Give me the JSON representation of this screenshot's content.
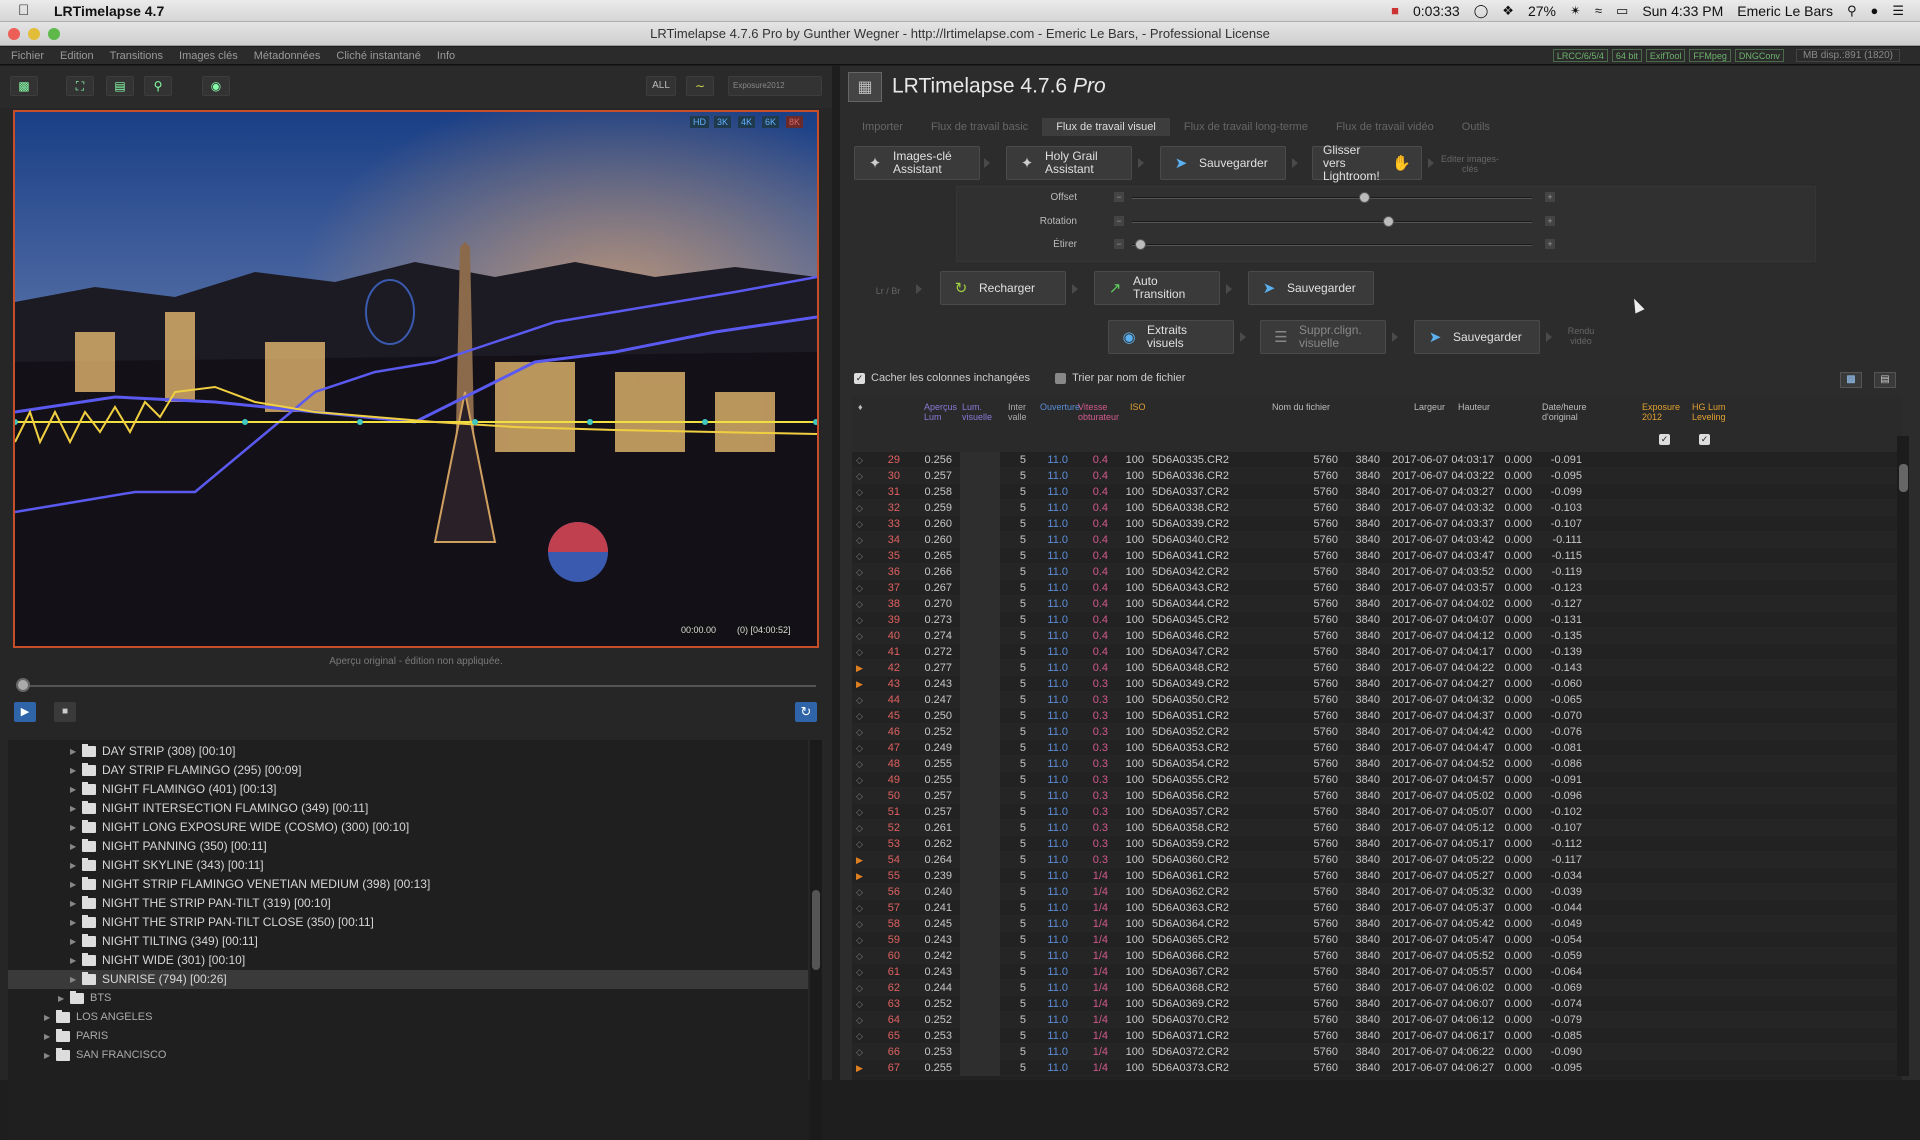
{
  "menubar": {
    "app": "LRTimelapse 4.7",
    "timer": "0:03:33",
    "battery": "27%",
    "clock": "Sun 4:33 PM",
    "user": "Emeric Le Bars"
  },
  "window": {
    "title": "LRTimelapse 4.7.6 Pro by Gunther Wegner - http://lrtimelapse.com - Emeric Le Bars, - Professional License"
  },
  "appmenu": {
    "items": [
      "Fichier",
      "Edition",
      "Transitions",
      "Images clés",
      "Métadonnées",
      "Cliché instantané",
      "Info"
    ],
    "badges": [
      "LRCC/6/5/4",
      "64 bit",
      "ExifTool",
      "FFMpeg",
      "DNGConv"
    ],
    "memory": "MB disp.:891 (1820)"
  },
  "toolbar": {
    "all_label": "ALL",
    "preset": "Exposure2012"
  },
  "preview": {
    "res": [
      "HD",
      "3K",
      "4K",
      "6K",
      "8K"
    ],
    "time_start": "00:00.00",
    "time_end": "(0) [04:00:52]",
    "caption": "Aperçu original - édition non appliquée."
  },
  "tree": {
    "items": [
      {
        "label": "DAY STRIP (308) [00:10]",
        "level": 3
      },
      {
        "label": "DAY STRIP FLAMINGO (295) [00:09]",
        "level": 3
      },
      {
        "label": "NIGHT FLAMINGO (401) [00:13]",
        "level": 3
      },
      {
        "label": "NIGHT INTERSECTION FLAMINGO (349) [00:11]",
        "level": 3
      },
      {
        "label": "NIGHT LONG EXPOSURE WIDE (COSMO) (300) [00:10]",
        "level": 3
      },
      {
        "label": "NIGHT PANNING (350) [00:11]",
        "level": 3
      },
      {
        "label": "NIGHT SKYLINE  (343) [00:11]",
        "level": 3
      },
      {
        "label": "NIGHT STRIP FLAMINGO VENETIAN MEDIUM (398) [00:13]",
        "level": 3
      },
      {
        "label": "NIGHT THE STRIP PAN-TILT (319) [00:10]",
        "level": 3
      },
      {
        "label": "NIGHT THE STRIP PAN-TILT CLOSE (350) [00:11]",
        "level": 3
      },
      {
        "label": "NIGHT TILTING (349) [00:11]",
        "level": 3
      },
      {
        "label": "NIGHT WIDE (301) [00:10]",
        "level": 3
      },
      {
        "label": "SUNRISE (794) [00:26]",
        "level": 3,
        "selected": true
      },
      {
        "label": "BTS",
        "level": 2
      },
      {
        "label": "LOS ANGELES",
        "level": 1
      },
      {
        "label": "PARIS",
        "level": 1
      },
      {
        "label": "SAN FRANCISCO",
        "level": 1
      }
    ]
  },
  "right": {
    "title": "LRTimelapse 4.7.6",
    "title_suffix": "Pro",
    "tabs": [
      "Importer",
      "Flux de travail basic",
      "Flux de travail visuel",
      "Flux de travail long-terme",
      "Flux de travail vidéo",
      "Outils"
    ],
    "active_tab": 2,
    "buttons": {
      "keyframes": "Images-clé Assistant",
      "holygrail": "Holy Grail Assistant",
      "save1": "Sauvegarder",
      "drag": "Glisser vers Lightroom!",
      "edit_label": "Editer images-clés",
      "lr_label": "Lr / Br",
      "reload": "Recharger",
      "auto": "Auto Transition",
      "save2": "Sauvegarder",
      "visual": "Extraits visuels",
      "deflicker": "Suppr.clign. visuelle",
      "save3": "Sauvegarder",
      "render_label": "Rendu vidéo"
    },
    "sliders": [
      {
        "label": "Offset",
        "value": 0.58
      },
      {
        "label": "Rotation",
        "value": 0.64
      },
      {
        "label": "Étirer",
        "value": 0.02
      }
    ],
    "checkbox1": "Cacher les colonnes inchangées",
    "checkbox2": "Trier par nom de fichier"
  },
  "table": {
    "headers": {
      "lum": "Aperçus Lum",
      "vis": "Lum. visuelle",
      "iv": "Inter valle",
      "ap": "Ouverture",
      "sh": "Vitesse obturateur",
      "iso": "ISO",
      "fn": "Nom du fichier",
      "w": "Largeur",
      "h": "Hauteur",
      "dt": "Date/heure d'original",
      "ex": "Exposure 2012",
      "hg": "HG Lum Leveling"
    },
    "rows": [
      [
        "29",
        "0.256",
        "5",
        "11.0",
        "0.4",
        "100",
        "5D6A0335.CR2",
        "5760",
        "3840",
        "2017-06-07 04:03:17",
        "0.000",
        "-0.091"
      ],
      [
        "30",
        "0.257",
        "5",
        "11.0",
        "0.4",
        "100",
        "5D6A0336.CR2",
        "5760",
        "3840",
        "2017-06-07 04:03:22",
        "0.000",
        "-0.095"
      ],
      [
        "31",
        "0.258",
        "5",
        "11.0",
        "0.4",
        "100",
        "5D6A0337.CR2",
        "5760",
        "3840",
        "2017-06-07 04:03:27",
        "0.000",
        "-0.099"
      ],
      [
        "32",
        "0.259",
        "5",
        "11.0",
        "0.4",
        "100",
        "5D6A0338.CR2",
        "5760",
        "3840",
        "2017-06-07 04:03:32",
        "0.000",
        "-0.103"
      ],
      [
        "33",
        "0.260",
        "5",
        "11.0",
        "0.4",
        "100",
        "5D6A0339.CR2",
        "5760",
        "3840",
        "2017-06-07 04:03:37",
        "0.000",
        "-0.107"
      ],
      [
        "34",
        "0.260",
        "5",
        "11.0",
        "0.4",
        "100",
        "5D6A0340.CR2",
        "5760",
        "3840",
        "2017-06-07 04:03:42",
        "0.000",
        "-0.111"
      ],
      [
        "35",
        "0.265",
        "5",
        "11.0",
        "0.4",
        "100",
        "5D6A0341.CR2",
        "5760",
        "3840",
        "2017-06-07 04:03:47",
        "0.000",
        "-0.115"
      ],
      [
        "36",
        "0.266",
        "5",
        "11.0",
        "0.4",
        "100",
        "5D6A0342.CR2",
        "5760",
        "3840",
        "2017-06-07 04:03:52",
        "0.000",
        "-0.119"
      ],
      [
        "37",
        "0.267",
        "5",
        "11.0",
        "0.4",
        "100",
        "5D6A0343.CR2",
        "5760",
        "3840",
        "2017-06-07 04:03:57",
        "0.000",
        "-0.123"
      ],
      [
        "38",
        "0.270",
        "5",
        "11.0",
        "0.4",
        "100",
        "5D6A0344.CR2",
        "5760",
        "3840",
        "2017-06-07 04:04:02",
        "0.000",
        "-0.127"
      ],
      [
        "39",
        "0.273",
        "5",
        "11.0",
        "0.4",
        "100",
        "5D6A0345.CR2",
        "5760",
        "3840",
        "2017-06-07 04:04:07",
        "0.000",
        "-0.131"
      ],
      [
        "40",
        "0.274",
        "5",
        "11.0",
        "0.4",
        "100",
        "5D6A0346.CR2",
        "5760",
        "3840",
        "2017-06-07 04:04:12",
        "0.000",
        "-0.135"
      ],
      [
        "41",
        "0.272",
        "5",
        "11.0",
        "0.4",
        "100",
        "5D6A0347.CR2",
        "5760",
        "3840",
        "2017-06-07 04:04:17",
        "0.000",
        "-0.139"
      ],
      [
        "42",
        "0.277",
        "5",
        "11.0",
        "0.4",
        "100",
        "5D6A0348.CR2",
        "5760",
        "3840",
        "2017-06-07 04:04:22",
        "0.000",
        "-0.143"
      ],
      [
        "43",
        "0.243",
        "5",
        "11.0",
        "0.3",
        "100",
        "5D6A0349.CR2",
        "5760",
        "3840",
        "2017-06-07 04:04:27",
        "0.000",
        "-0.060"
      ],
      [
        "44",
        "0.247",
        "5",
        "11.0",
        "0.3",
        "100",
        "5D6A0350.CR2",
        "5760",
        "3840",
        "2017-06-07 04:04:32",
        "0.000",
        "-0.065"
      ],
      [
        "45",
        "0.250",
        "5",
        "11.0",
        "0.3",
        "100",
        "5D6A0351.CR2",
        "5760",
        "3840",
        "2017-06-07 04:04:37",
        "0.000",
        "-0.070"
      ],
      [
        "46",
        "0.252",
        "5",
        "11.0",
        "0.3",
        "100",
        "5D6A0352.CR2",
        "5760",
        "3840",
        "2017-06-07 04:04:42",
        "0.000",
        "-0.076"
      ],
      [
        "47",
        "0.249",
        "5",
        "11.0",
        "0.3",
        "100",
        "5D6A0353.CR2",
        "5760",
        "3840",
        "2017-06-07 04:04:47",
        "0.000",
        "-0.081"
      ],
      [
        "48",
        "0.255",
        "5",
        "11.0",
        "0.3",
        "100",
        "5D6A0354.CR2",
        "5760",
        "3840",
        "2017-06-07 04:04:52",
        "0.000",
        "-0.086"
      ],
      [
        "49",
        "0.255",
        "5",
        "11.0",
        "0.3",
        "100",
        "5D6A0355.CR2",
        "5760",
        "3840",
        "2017-06-07 04:04:57",
        "0.000",
        "-0.091"
      ],
      [
        "50",
        "0.257",
        "5",
        "11.0",
        "0.3",
        "100",
        "5D6A0356.CR2",
        "5760",
        "3840",
        "2017-06-07 04:05:02",
        "0.000",
        "-0.096"
      ],
      [
        "51",
        "0.257",
        "5",
        "11.0",
        "0.3",
        "100",
        "5D6A0357.CR2",
        "5760",
        "3840",
        "2017-06-07 04:05:07",
        "0.000",
        "-0.102"
      ],
      [
        "52",
        "0.261",
        "5",
        "11.0",
        "0.3",
        "100",
        "5D6A0358.CR2",
        "5760",
        "3840",
        "2017-06-07 04:05:12",
        "0.000",
        "-0.107"
      ],
      [
        "53",
        "0.262",
        "5",
        "11.0",
        "0.3",
        "100",
        "5D6A0359.CR2",
        "5760",
        "3840",
        "2017-06-07 04:05:17",
        "0.000",
        "-0.112"
      ],
      [
        "54",
        "0.264",
        "5",
        "11.0",
        "0.3",
        "100",
        "5D6A0360.CR2",
        "5760",
        "3840",
        "2017-06-07 04:05:22",
        "0.000",
        "-0.117"
      ],
      [
        "55",
        "0.239",
        "5",
        "11.0",
        "1/4",
        "100",
        "5D6A0361.CR2",
        "5760",
        "3840",
        "2017-06-07 04:05:27",
        "0.000",
        "-0.034"
      ],
      [
        "56",
        "0.240",
        "5",
        "11.0",
        "1/4",
        "100",
        "5D6A0362.CR2",
        "5760",
        "3840",
        "2017-06-07 04:05:32",
        "0.000",
        "-0.039"
      ],
      [
        "57",
        "0.241",
        "5",
        "11.0",
        "1/4",
        "100",
        "5D6A0363.CR2",
        "5760",
        "3840",
        "2017-06-07 04:05:37",
        "0.000",
        "-0.044"
      ],
      [
        "58",
        "0.245",
        "5",
        "11.0",
        "1/4",
        "100",
        "5D6A0364.CR2",
        "5760",
        "3840",
        "2017-06-07 04:05:42",
        "0.000",
        "-0.049"
      ],
      [
        "59",
        "0.243",
        "5",
        "11.0",
        "1/4",
        "100",
        "5D6A0365.CR2",
        "5760",
        "3840",
        "2017-06-07 04:05:47",
        "0.000",
        "-0.054"
      ],
      [
        "60",
        "0.242",
        "5",
        "11.0",
        "1/4",
        "100",
        "5D6A0366.CR2",
        "5760",
        "3840",
        "2017-06-07 04:05:52",
        "0.000",
        "-0.059"
      ],
      [
        "61",
        "0.243",
        "5",
        "11.0",
        "1/4",
        "100",
        "5D6A0367.CR2",
        "5760",
        "3840",
        "2017-06-07 04:05:57",
        "0.000",
        "-0.064"
      ],
      [
        "62",
        "0.244",
        "5",
        "11.0",
        "1/4",
        "100",
        "5D6A0368.CR2",
        "5760",
        "3840",
        "2017-06-07 04:06:02",
        "0.000",
        "-0.069"
      ],
      [
        "63",
        "0.252",
        "5",
        "11.0",
        "1/4",
        "100",
        "5D6A0369.CR2",
        "5760",
        "3840",
        "2017-06-07 04:06:07",
        "0.000",
        "-0.074"
      ],
      [
        "64",
        "0.252",
        "5",
        "11.0",
        "1/4",
        "100",
        "5D6A0370.CR2",
        "5760",
        "3840",
        "2017-06-07 04:06:12",
        "0.000",
        "-0.079"
      ],
      [
        "65",
        "0.253",
        "5",
        "11.0",
        "1/4",
        "100",
        "5D6A0371.CR2",
        "5760",
        "3840",
        "2017-06-07 04:06:17",
        "0.000",
        "-0.085"
      ],
      [
        "66",
        "0.253",
        "5",
        "11.0",
        "1/4",
        "100",
        "5D6A0372.CR2",
        "5760",
        "3840",
        "2017-06-07 04:06:22",
        "0.000",
        "-0.090"
      ],
      [
        "67",
        "0.255",
        "5",
        "11.0",
        "1/4",
        "100",
        "5D6A0373.CR2",
        "5760",
        "3840",
        "2017-06-07 04:06:27",
        "0.000",
        "-0.095"
      ]
    ]
  },
  "colors": {
    "accent_blue": "#2f64a8",
    "row_number": "#e06060",
    "aperture": "#5b8fd9",
    "shutter": "#d05a8a",
    "exposure_header": "#e0a030",
    "hg_header": "#e0a030",
    "lum_header": "#8a7ad9",
    "preview_border": "#c74e2a"
  }
}
